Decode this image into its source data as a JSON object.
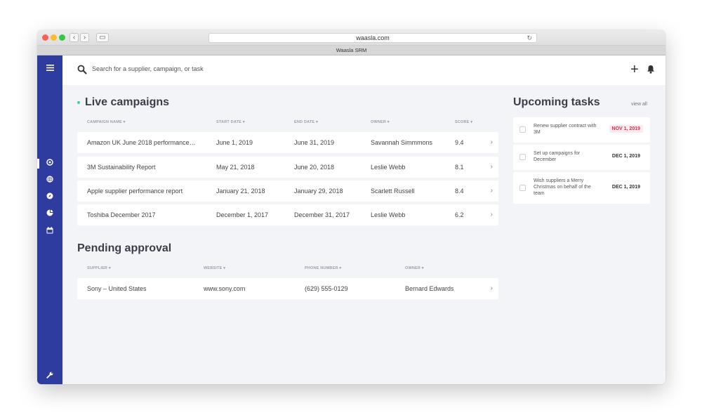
{
  "browser": {
    "url": "waasla.com",
    "tab_title": "Waasla SRM",
    "icons": [
      "close-dot",
      "minimize-dot",
      "zoom-dot",
      "back-icon",
      "forward-icon",
      "sidebar-toggle-icon",
      "reload-icon"
    ]
  },
  "colors": {
    "sidebar": "#2e3b9f",
    "live": "#3dd39a",
    "overdue": "#e2284b",
    "background": "#f3f4f8"
  },
  "sidebar": {
    "items": [
      {
        "icon": "menu-icon"
      },
      {
        "icon": "target-icon",
        "active": true
      },
      {
        "icon": "globe-icon"
      },
      {
        "icon": "compass-icon"
      },
      {
        "icon": "pie-chart-icon"
      },
      {
        "icon": "calendar-icon"
      },
      {
        "icon": "wrench-icon"
      },
      {
        "icon": "power-icon"
      }
    ]
  },
  "search": {
    "placeholder": "Search for a supplier, campaign, or task"
  },
  "header": {
    "add_label": "+"
  },
  "live_campaigns": {
    "title": "Live campaigns",
    "columns": [
      "CAMPAIGN NAME ▾",
      "START DATE ▾",
      "END DATE ▾",
      "OWNER ▾",
      "SCORE ▾"
    ],
    "rows": [
      {
        "name": "Amazon UK June 2018 performance…",
        "start": "June 1, 2019",
        "end": "June 31, 2019",
        "owner": "Savannah Simmmons",
        "score": "9.4"
      },
      {
        "name": "3M Sustainability Report",
        "start": "May 21, 2018",
        "end": "June 20, 2018",
        "owner": "Leslie Webb",
        "score": "8.1"
      },
      {
        "name": "Apple supplier performance report",
        "start": "January 21, 2018",
        "end": "January 29, 2018",
        "owner": "Scarlett Russell",
        "score": "8.4"
      },
      {
        "name": "Toshiba December 2017",
        "start": "December 1, 2017",
        "end": "December 31, 2017",
        "owner": "Leslie Webb",
        "score": "6.2"
      }
    ]
  },
  "pending_approval": {
    "title": "Pending approval",
    "columns": [
      "SUPPLIER ▾",
      "WEBSITE ▾",
      "PHONE NUMBER ▾",
      "OWNER ▾"
    ],
    "rows": [
      {
        "supplier": "Sony – United States",
        "website": "www.sony.com",
        "phone": "(629) 555-0129",
        "owner": "Bernard Edwards"
      }
    ]
  },
  "upcoming_tasks": {
    "title": "Upcoming tasks",
    "view_all": "view all",
    "tasks": [
      {
        "text": "Renew supplier contract with 3M",
        "due": "NOV 1, 2019",
        "overdue": true
      },
      {
        "text": "Set up campaigns for December",
        "due": "DEC 1, 2019",
        "overdue": false
      },
      {
        "text": "Wish suppliers a Merry Christmas on behalf of the team",
        "due": "DEC 1, 2019",
        "overdue": false
      }
    ]
  }
}
